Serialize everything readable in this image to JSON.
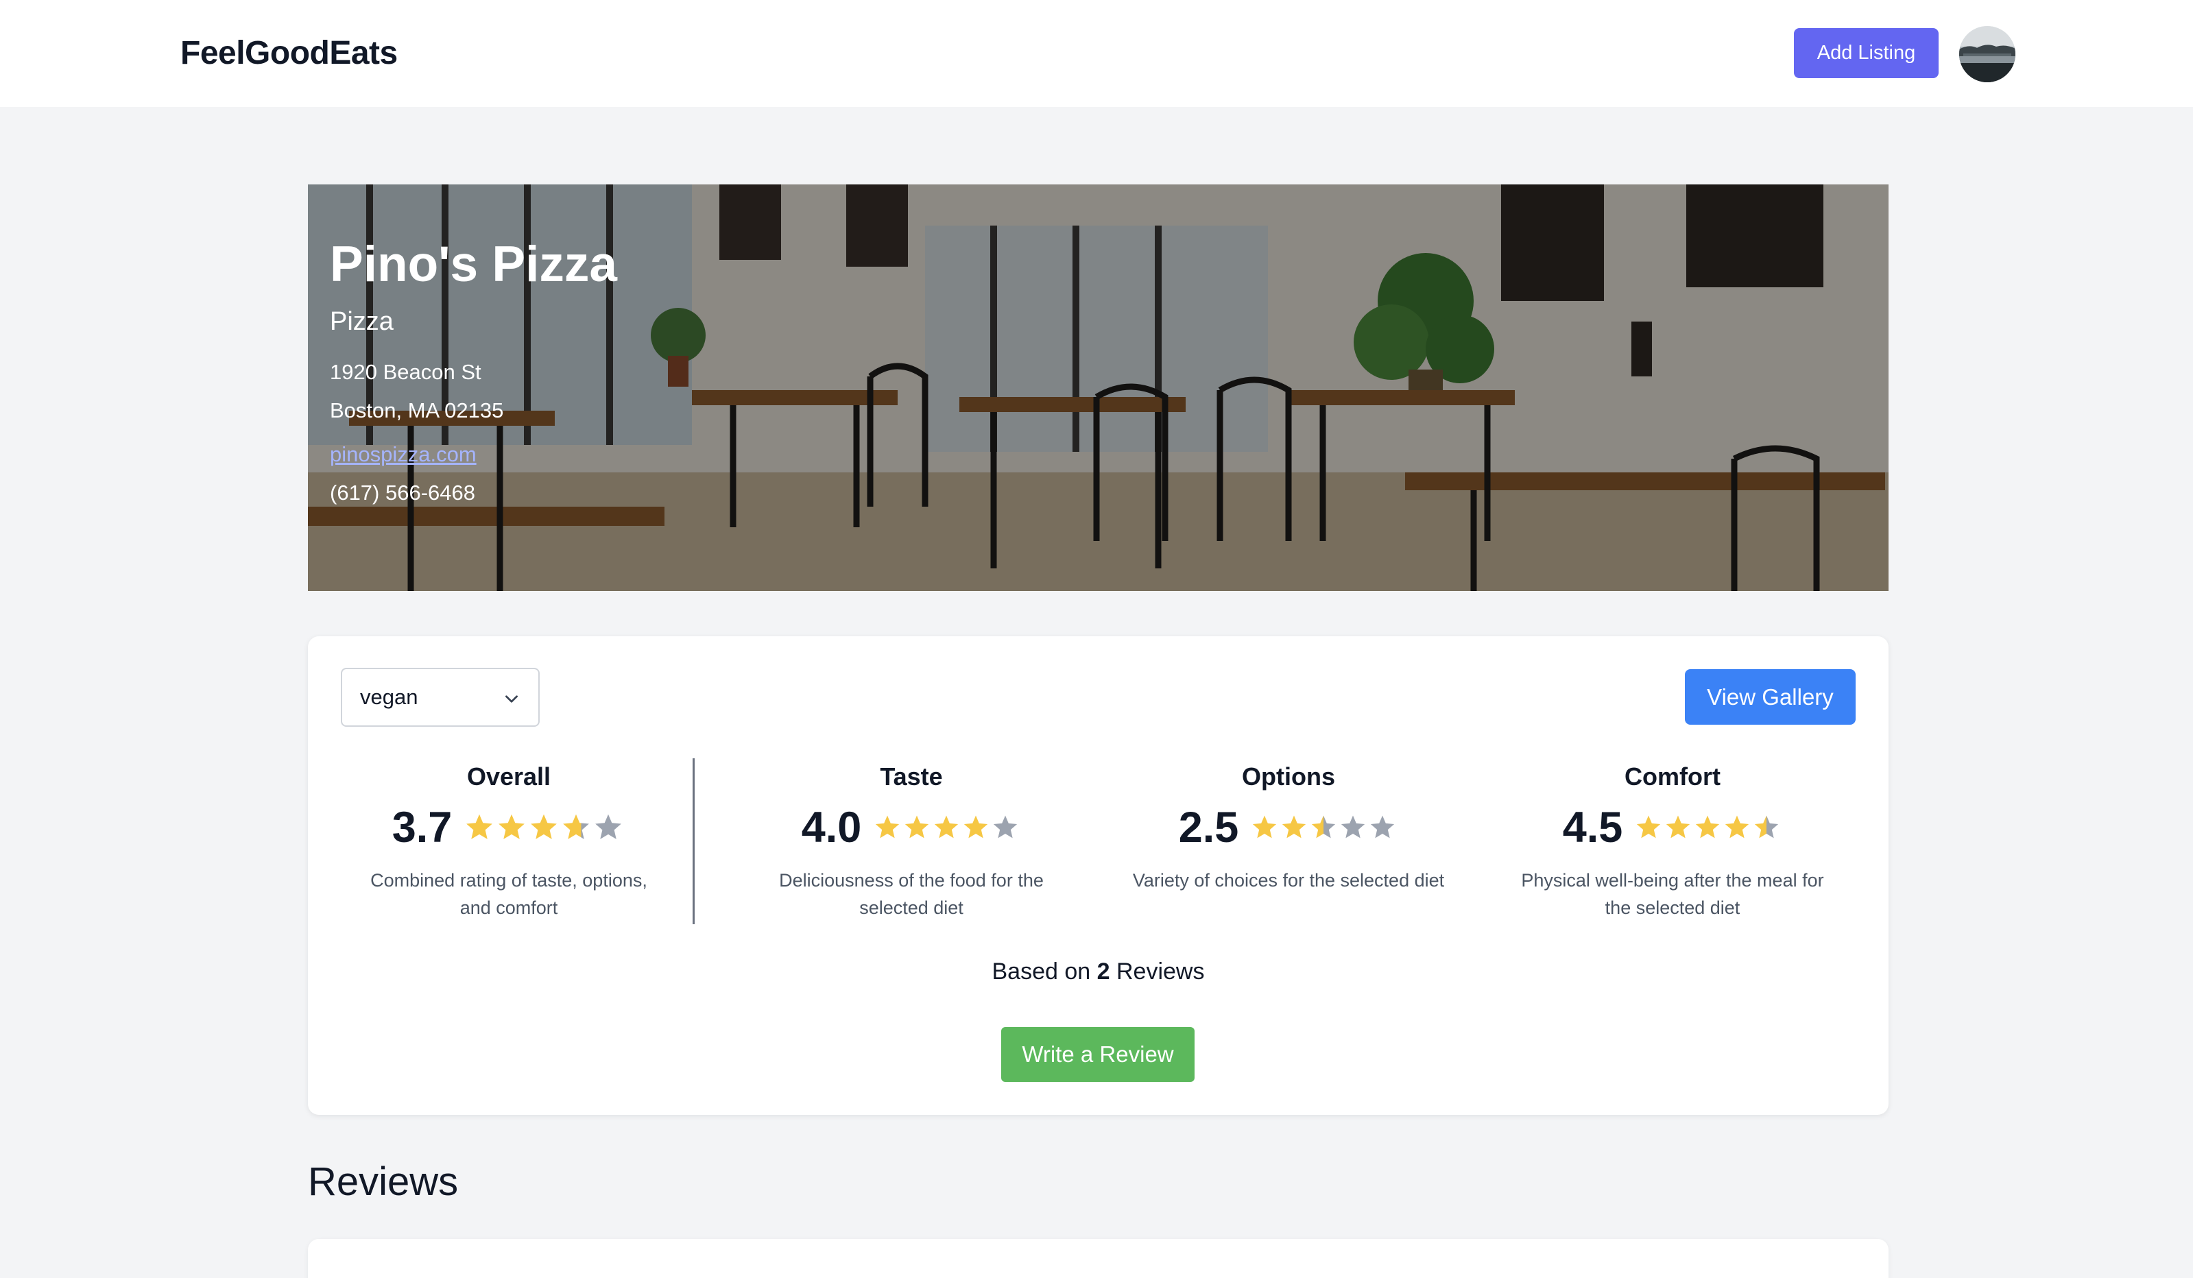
{
  "brand": "FeelGoodEats",
  "header": {
    "add_listing_label": "Add Listing"
  },
  "restaurant": {
    "name": "Pino's Pizza",
    "category": "Pizza",
    "address_line1": "1920 Beacon St",
    "address_line2": "Boston, MA 02135",
    "website": "pinospizza.com",
    "phone": "(617) 566-6468"
  },
  "filter": {
    "selected": "vegan"
  },
  "view_gallery_label": "View Gallery",
  "ratings": [
    {
      "title": "Overall",
      "score": "3.7",
      "value": 3.7,
      "desc_line1": "Combined rating of taste, options,",
      "desc_line2": "and comfort"
    },
    {
      "title": "Taste",
      "score": "4.0",
      "value": 4.0,
      "desc_line1": "Deliciousness of the food for the",
      "desc_line2": "selected diet"
    },
    {
      "title": "Options",
      "score": "2.5",
      "value": 2.5,
      "desc_line1": "Variety of choices for the selected diet",
      "desc_line2": ""
    },
    {
      "title": "Comfort",
      "score": "4.5",
      "value": 4.5,
      "desc_line1": "Physical well-being after the meal for",
      "desc_line2": "the selected diet"
    }
  ],
  "summary": {
    "prefix": "Based on",
    "count": "2",
    "suffix": "Reviews"
  },
  "write_review_label": "Write a Review",
  "reviews_heading": "Reviews",
  "colors": {
    "brand_button": "#6366f1",
    "gallery_button": "#3b82f6",
    "review_button": "#5cb85c",
    "star_filled": "#f6c744",
    "star_empty": "#9ca3af"
  }
}
